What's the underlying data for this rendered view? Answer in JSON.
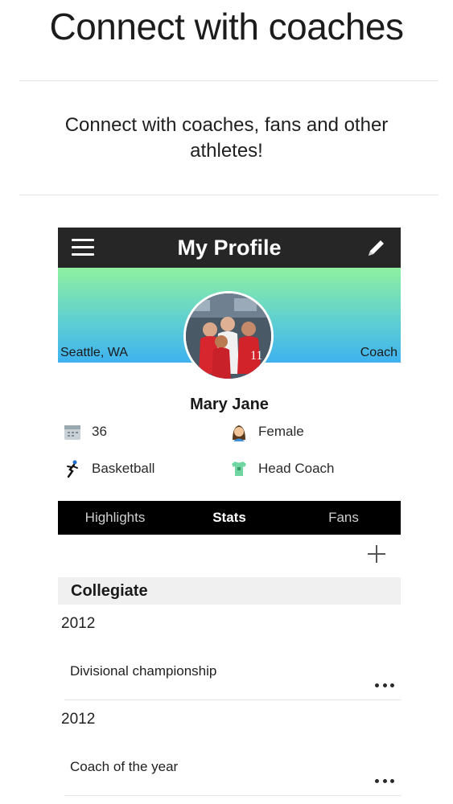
{
  "hero": {
    "title": "Connect with coaches",
    "subtitle": "Connect with coaches, fans and other athletes!"
  },
  "app": {
    "navbar": {
      "title": "My Profile",
      "menu_icon": "hamburger-menu-icon",
      "edit_icon": "pencil-icon"
    },
    "banner": {
      "location": "Seattle, WA",
      "role": "Coach"
    },
    "profile": {
      "name": "Mary Jane",
      "age": "36",
      "gender": "Female",
      "sport": "Basketball",
      "position": "Head Coach"
    },
    "tabs": [
      {
        "label": "Highlights",
        "active": false
      },
      {
        "label": "Stats",
        "active": true
      },
      {
        "label": "Fans",
        "active": false
      }
    ],
    "add_icon": "plus-icon",
    "section": {
      "title": "Collegiate",
      "items": [
        {
          "year": "2012",
          "title": "Divisional championship"
        },
        {
          "year": "2012",
          "title": "Coach of the year"
        }
      ]
    },
    "colors": {
      "navbar": "#262626",
      "tabs": "#000000",
      "banner_top": "#8ff0a0",
      "banner_bottom": "#3fb2ef"
    }
  }
}
